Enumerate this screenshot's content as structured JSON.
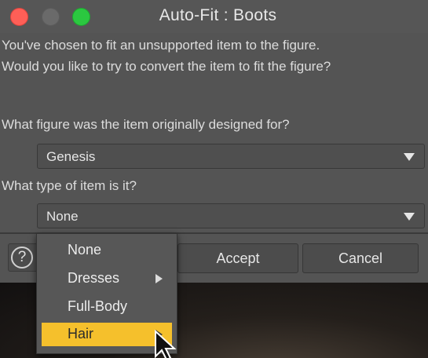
{
  "window": {
    "title": "Auto-Fit : Boots"
  },
  "message": {
    "line1": "You've chosen to fit an unsupported item to the figure.",
    "line2": "Would you like to try to convert the item to fit the figure?"
  },
  "figure_question": {
    "label": "What figure was the item originally designed for?",
    "selected": "Genesis"
  },
  "item_type_question": {
    "label": "What type of item is it?",
    "selected": "None"
  },
  "buttons": {
    "help": "?",
    "accept": "Accept",
    "cancel": "Cancel"
  },
  "item_type_menu": {
    "items": [
      {
        "label": "None",
        "has_submenu": false,
        "highlighted": false
      },
      {
        "label": "Dresses",
        "has_submenu": true,
        "highlighted": false
      },
      {
        "label": "Full-Body",
        "has_submenu": false,
        "highlighted": false
      },
      {
        "label": "Hair",
        "has_submenu": true,
        "highlighted": true
      }
    ]
  },
  "colors": {
    "highlight": "#f5c02c",
    "dialog_bg": "#545454",
    "close": "#fe5f57",
    "maximize": "#2bc840"
  }
}
